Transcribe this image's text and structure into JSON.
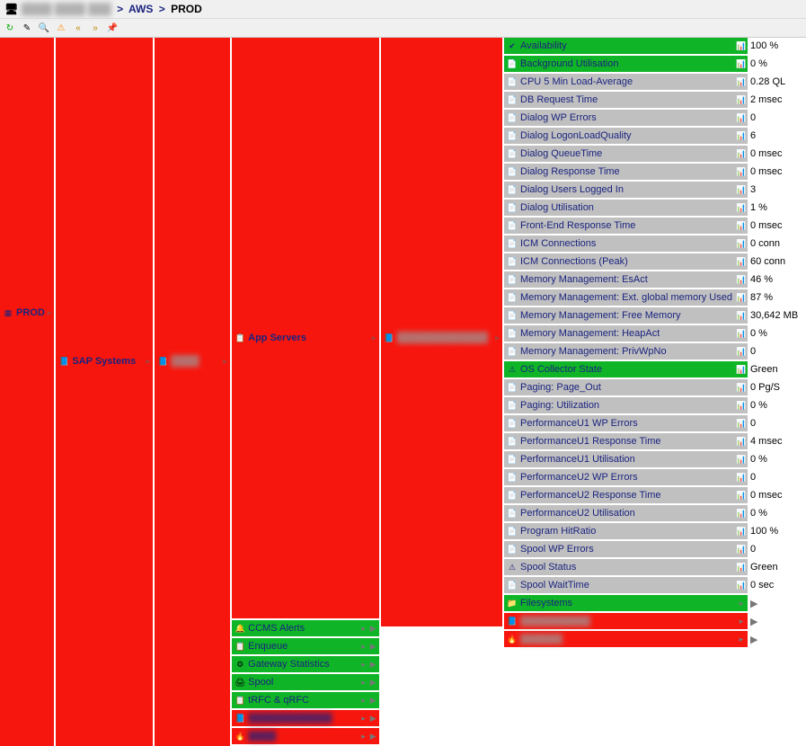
{
  "breadcrumb": {
    "prefix_blur": "████ ████ ███",
    "sep": ">",
    "mid": "AWS",
    "current": "PROD"
  },
  "toolbar": {
    "refresh": "↻",
    "edit": "✎",
    "search": "🔍",
    "warn": "⚠",
    "prev": "«",
    "next": "»",
    "pin": "📌"
  },
  "col1": {
    "label": "PROD"
  },
  "col2": {
    "label": "SAP Systems"
  },
  "col3": {
    "label": "████"
  },
  "col4": {
    "label": "App Servers"
  },
  "col5": {
    "label": "█████████████"
  },
  "metrics": [
    {
      "name": "Availability",
      "value": "100 %",
      "bg": "green",
      "icon": "✔"
    },
    {
      "name": "Background Utilisation",
      "value": "0 %",
      "bg": "green",
      "icon": "📄"
    },
    {
      "name": "CPU 5 Min Load-Average",
      "value": "0.28 QL",
      "bg": "gray",
      "icon": "📄"
    },
    {
      "name": "DB Request Time",
      "value": "2 msec",
      "bg": "gray",
      "icon": "📄"
    },
    {
      "name": "Dialog WP Errors",
      "value": "0",
      "bg": "gray",
      "icon": "📄"
    },
    {
      "name": "Dialog LogonLoadQuality",
      "value": "6",
      "bg": "gray",
      "icon": "📄"
    },
    {
      "name": "Dialog QueueTime",
      "value": "0 msec",
      "bg": "gray",
      "icon": "📄"
    },
    {
      "name": "Dialog Response Time",
      "value": "0 msec",
      "bg": "gray",
      "icon": "📄"
    },
    {
      "name": "Dialog Users Logged In",
      "value": "3",
      "bg": "gray",
      "icon": "📄"
    },
    {
      "name": "Dialog Utilisation",
      "value": "1 %",
      "bg": "gray",
      "icon": "📄"
    },
    {
      "name": "Front-End Response Time",
      "value": "0 msec",
      "bg": "gray",
      "icon": "📄"
    },
    {
      "name": "ICM Connections",
      "value": "0 conn",
      "bg": "gray",
      "icon": "📄"
    },
    {
      "name": "ICM Connections (Peak)",
      "value": "60 conn",
      "bg": "gray",
      "icon": "📄"
    },
    {
      "name": "Memory Management: EsAct",
      "value": "46 %",
      "bg": "gray",
      "icon": "📄"
    },
    {
      "name": "Memory Management: Ext. global memory Used",
      "value": "87 %",
      "bg": "gray",
      "icon": "📄"
    },
    {
      "name": "Memory Management: Free Memory",
      "value": "30,642 MB",
      "bg": "gray",
      "icon": "📄"
    },
    {
      "name": "Memory Management: HeapAct",
      "value": "0 %",
      "bg": "gray",
      "icon": "📄"
    },
    {
      "name": "Memory Management: PrivWpNo",
      "value": "0",
      "bg": "gray",
      "icon": "📄"
    },
    {
      "name": "OS Collector State",
      "value": "Green",
      "bg": "green",
      "icon": "⚠"
    },
    {
      "name": "Paging: Page_Out",
      "value": "0 Pg/S",
      "bg": "gray",
      "icon": "📄"
    },
    {
      "name": "Paging: Utilization",
      "value": "0 %",
      "bg": "gray",
      "icon": "📄"
    },
    {
      "name": "PerformanceU1 WP Errors",
      "value": "0",
      "bg": "gray",
      "icon": "📄"
    },
    {
      "name": "PerformanceU1 Response Time",
      "value": "4 msec",
      "bg": "gray",
      "icon": "📄"
    },
    {
      "name": "PerformanceU1 Utilisation",
      "value": "0 %",
      "bg": "gray",
      "icon": "📄"
    },
    {
      "name": "PerformanceU2 WP Errors",
      "value": "0",
      "bg": "gray",
      "icon": "📄"
    },
    {
      "name": "PerformanceU2 Response Time",
      "value": "0 msec",
      "bg": "gray",
      "icon": "📄"
    },
    {
      "name": "PerformanceU2 Utilisation",
      "value": "0 %",
      "bg": "gray",
      "icon": "📄"
    },
    {
      "name": "Program HitRatio",
      "value": "100 %",
      "bg": "gray",
      "icon": "📄"
    },
    {
      "name": "Spool WP Errors",
      "value": "0",
      "bg": "gray",
      "icon": "📄"
    },
    {
      "name": "Spool Status",
      "value": "Green",
      "bg": "gray",
      "icon": "⚠"
    },
    {
      "name": "Spool WaitTime",
      "value": "0 sec",
      "bg": "gray",
      "icon": "📄"
    }
  ],
  "metric_groups": [
    {
      "name": "Filesystems",
      "bg": "green",
      "icon": "📁"
    },
    {
      "name": "██████████",
      "bg": "red",
      "icon": "📘",
      "blur": true
    },
    {
      "name": "██████",
      "bg": "red",
      "icon": "🔥",
      "blur": true
    }
  ],
  "app_groups": [
    {
      "name": "CCMS Alerts",
      "bg": "green",
      "icon": "🔔"
    },
    {
      "name": "Enqueue",
      "bg": "green",
      "icon": "📋"
    },
    {
      "name": "Gateway Statistics",
      "bg": "green",
      "icon": "⚙"
    },
    {
      "name": "Spool",
      "bg": "green",
      "icon": "🖨"
    },
    {
      "name": "tRFC & qRFC",
      "bg": "green",
      "icon": "📋"
    },
    {
      "name": "████████████",
      "bg": "red",
      "icon": "📘",
      "blur": true
    },
    {
      "name": "████",
      "bg": "red",
      "icon": "🔥",
      "blur": true
    }
  ]
}
